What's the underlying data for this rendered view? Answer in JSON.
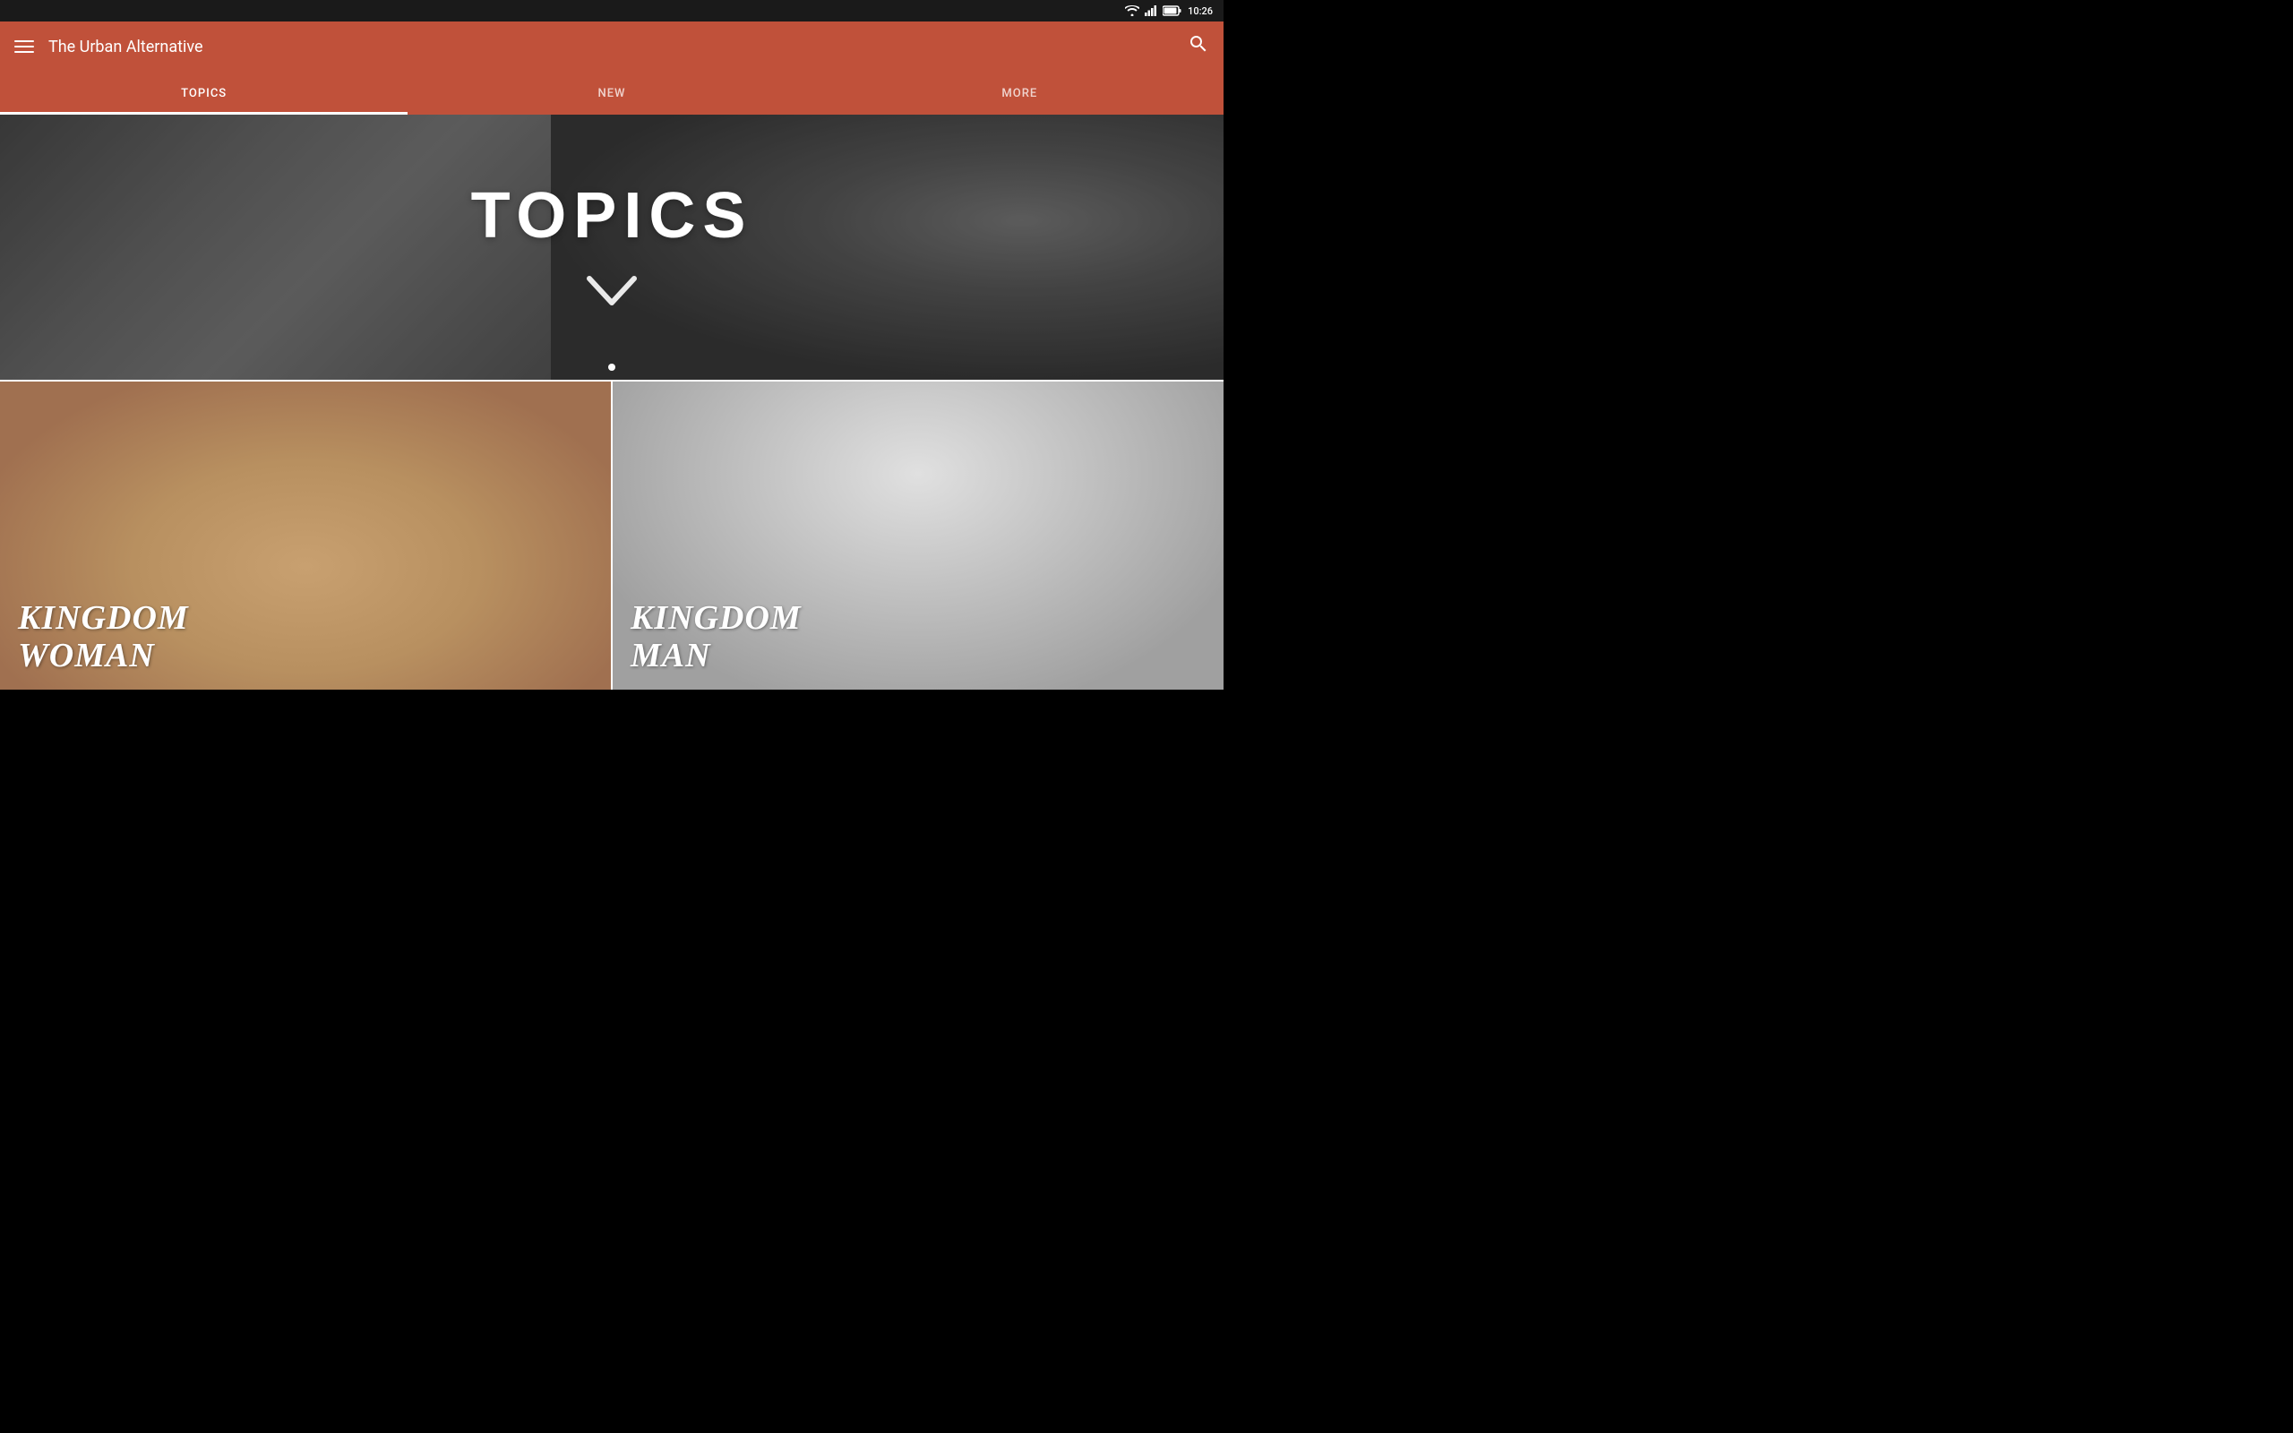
{
  "status_bar": {
    "time": "10:26",
    "wifi_icon": "wifi",
    "signal_icon": "signal",
    "battery_icon": "battery"
  },
  "app_bar": {
    "menu_icon": "hamburger-menu",
    "title": "The Urban Alternative",
    "search_icon": "search"
  },
  "tabs": [
    {
      "label": "TOPICS",
      "active": true
    },
    {
      "label": "NEW",
      "active": false
    },
    {
      "label": "MORE",
      "active": false
    }
  ],
  "hero": {
    "title": "TOPICS",
    "chevron_icon": "chevron-down",
    "dots": [
      {
        "active": true
      }
    ]
  },
  "cards": [
    {
      "title_line1": "KINGDOM",
      "title_line2": "WOMAN"
    },
    {
      "title_line1": "KINGDOM",
      "title_line2": "MAN"
    }
  ]
}
